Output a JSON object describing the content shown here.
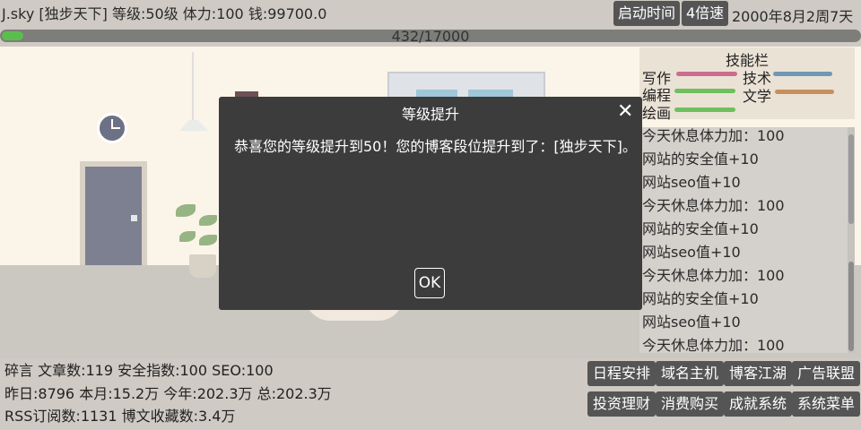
{
  "status": {
    "line": "J.sky [独步天下] 等级:50级 体力:100 钱:99700.0",
    "start_time_label": "启动时间",
    "speed_label": "4倍速",
    "date": "2000年8月2周7天"
  },
  "exp": {
    "text": "432/17000",
    "progress": 0.0254
  },
  "skills": {
    "title": "技能栏",
    "items": [
      {
        "label": "写作",
        "color": "#cc6c8e"
      },
      {
        "label": "技术",
        "color": "#6f97b6"
      },
      {
        "label": "编程",
        "color": "#6fbf5f"
      },
      {
        "label": "文学",
        "color": "#c98f5b"
      },
      {
        "label": "绘画",
        "color": "#6fbf5f"
      }
    ]
  },
  "log": [
    "今天休息体力加：100",
    "网站的安全值+10",
    "网站seo值+10",
    "今天休息体力加：100",
    "网站的安全值+10",
    "网站seo值+10",
    "今天休息体力加：100",
    "网站的安全值+10",
    "网站seo值+10",
    "今天休息体力加：100"
  ],
  "stats": {
    "line1": "碎言 文章数:119 安全指数:100 SEO:100",
    "line2": "昨日:8796 本月:15.2万 今年:202.3万 总:202.3万",
    "line3": "RSS订阅数:1131 博文收藏数:3.4万"
  },
  "menu": {
    "row1": [
      "日程安排",
      "域名主机",
      "博客江湖",
      "广告联盟"
    ],
    "row2": [
      "投资理财",
      "消费购买",
      "成就系统",
      "系统菜单"
    ]
  },
  "modal": {
    "title": "等级提升",
    "message": "恭喜您的等级提升到50！您的博客段位提升到了：[独步天下]。",
    "ok_label": "OK"
  }
}
